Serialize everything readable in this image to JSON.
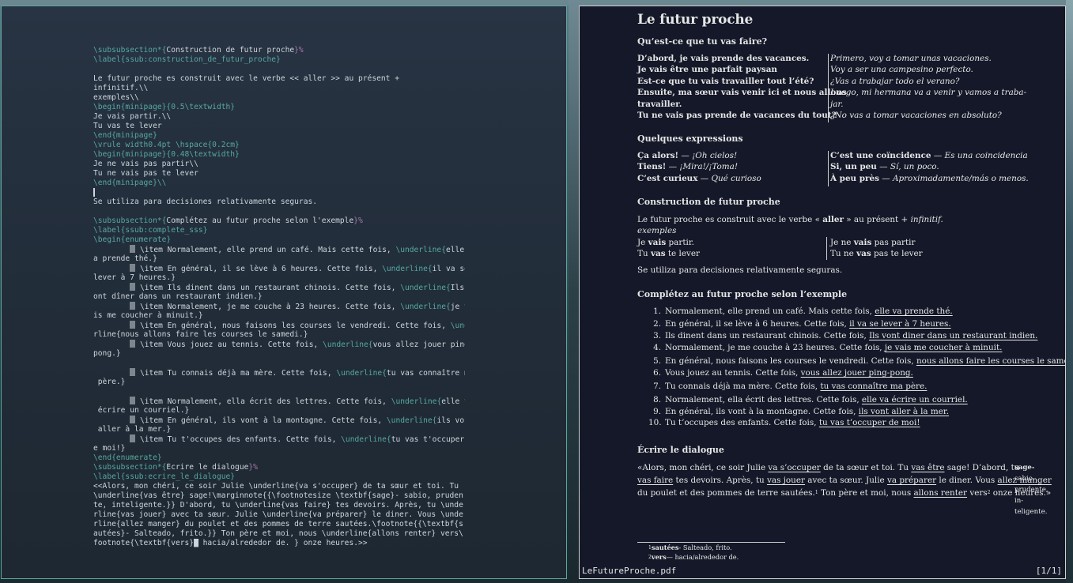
{
  "editor": {
    "lines": [
      [
        "",
        "\\subsubsection*{",
        "Construction de futur proche",
        "}%"
      ],
      [
        "",
        "\\label{ssub:construction_de_futur_proche}",
        "",
        ""
      ],
      [
        "",
        "",
        "",
        ""
      ],
      [
        "Le futur proche es construit avec le verbe << aller >> au présent +",
        "",
        "",
        ""
      ],
      [
        "infinitif.\\\\",
        "",
        "",
        ""
      ],
      [
        "exemples\\\\",
        "",
        "",
        ""
      ],
      [
        "",
        "\\begin{minipage}",
        "{0.5\\textwidth}",
        ""
      ],
      [
        "Je vais partir.\\\\",
        "",
        "",
        ""
      ],
      [
        "Tu vas te lever",
        "",
        "",
        ""
      ],
      [
        "",
        "\\end{minipage}",
        "",
        ""
      ],
      [
        "",
        "\\vrule width",
        "0.4pt \\hspace{0.2cm}",
        ""
      ],
      [
        "",
        "\\begin{minipage}",
        "{0.48\\textwidth}",
        ""
      ],
      [
        "Je ne vais pas partir\\\\",
        "",
        "",
        ""
      ],
      [
        "Tu ne vais pas te lever",
        "",
        "",
        ""
      ],
      [
        "",
        "\\end{minipage}\\\\",
        "",
        ""
      ],
      [
        "CURSOR",
        "",
        "",
        ""
      ],
      [
        "Se utiliza para decisiones relativamente seguras.",
        "",
        "",
        ""
      ],
      [
        "",
        "",
        "",
        ""
      ],
      [
        "",
        "\\subsubsection*{",
        "Complétez au futur proche selon l'exemple",
        "}%"
      ],
      [
        "",
        "\\label{ssub:complete_sss}",
        "",
        ""
      ],
      [
        "",
        "\\begin{enumerate}",
        "",
        ""
      ],
      [
        "ITEM",
        "Normalement, elle prend un café. Mais cette fois, ",
        "\\underline{",
        "elle v"
      ],
      [
        "a prende thé.}",
        "",
        "",
        ""
      ],
      [
        "ITEM",
        "En général, il se lève à 6 heures. Cette fois, ",
        "\\underline{",
        "il va se"
      ],
      [
        "lever à 7 heures.}",
        "",
        "",
        ""
      ],
      [
        "ITEM",
        "Ils dinent dans un restaurant chinois. Cette fois, ",
        "\\underline{",
        "Ils v"
      ],
      [
        "ont dîner dans un restaurant indien.}",
        "",
        "",
        ""
      ],
      [
        "ITEM",
        "Normalement, je me couche à 23 heures. Cette fois, ",
        "\\underline{",
        "je va"
      ],
      [
        "is me coucher à minuit.}",
        "",
        "",
        ""
      ],
      [
        "ITEM",
        "En général, nous faisons les courses le vendredi. Cette fois, ",
        "\\unde",
        ""
      ],
      [
        "rline{nous allons faire les courses le samedi.}",
        "",
        "",
        ""
      ],
      [
        "ITEM",
        "Vous jouez au tennis. Cette fois, ",
        "\\underline{",
        "vous allez jouer ping-"
      ],
      [
        "pong.}",
        "",
        "",
        ""
      ],
      [
        "",
        "",
        "",
        ""
      ],
      [
        "ITEM",
        "Tu connais déjà ma mère. Cette fois, ",
        "\\underline{",
        "tu vas connaître ma"
      ],
      [
        " père.}",
        "",
        "",
        ""
      ],
      [
        "",
        "",
        "",
        ""
      ],
      [
        "ITEM",
        "Normalement, ella écrit des lettres. Cette fois, ",
        "\\underline{",
        "elle va"
      ],
      [
        " écrire un courriel.}",
        "",
        "",
        ""
      ],
      [
        "ITEM",
        "En général, ils vont à la montagne. Cette fois, ",
        "\\underline{",
        "ils vont"
      ],
      [
        " aller à la mer.}",
        "",
        "",
        ""
      ],
      [
        "ITEM",
        "Tu t'occupes des enfants. Cette fois, ",
        "\\underline{",
        "tu vas t'occuper d"
      ],
      [
        "e moi!}",
        "",
        "",
        ""
      ],
      [
        "",
        "\\end{enumerate}",
        "",
        ""
      ],
      [
        "",
        "\\subsubsection*{",
        "Écrire le dialogue",
        "}%"
      ],
      [
        "",
        "\\label{ssub:ecrire_le_dialogue}",
        "",
        ""
      ],
      [
        "<<Alors, mon chéri, ce soir Julie \\underline{va s'occuper} de ta sœur et toi. Tu",
        "",
        "",
        ""
      ],
      [
        "\\underline{vas être} sage!\\marginnote{{\\footnotesize \\textbf{sage}- sabio, pruden",
        "",
        "",
        ""
      ],
      [
        "te, inteligente.}} D'abord, tu \\underline{vas faire} tes devoirs. Après, tu \\unde",
        "",
        "",
        ""
      ],
      [
        "rline{vas jouer} avec ta sœur. Julie \\underline{va préparer} le diner. Vous \\unde",
        "",
        "",
        ""
      ],
      [
        "rline{allez manger} du poulet et des pommes de terre sautées.\\footnote{{\\textbf{s",
        "",
        "",
        ""
      ],
      [
        "autées}- Salteado, frito.}} Ton père et moi, nous \\underline{allons renter} vers\\",
        "",
        "",
        ""
      ],
      [
        "footnote{\\textbf{vers}█ hacia/alrededor de. } onze heures.>>",
        "",
        "",
        ""
      ]
    ]
  },
  "viewer": {
    "title": "Le futur proche",
    "s1_title": "Qu’est-ce que tu vas faire?",
    "s1_left": [
      "D’abord, je vais prende des vacances.",
      "Je vais être une parfait paysan",
      "Est-ce que tu vais travailler tout l’été?",
      "Ensuite, ma sœur vais venir ici et nous allons",
      "travailler.",
      "Tu ne vais pas prende de vacances du tout?"
    ],
    "s1_right": [
      "Primero, voy a tomar unas vacaciones.",
      "Voy a ser una campesino perfecto.",
      "¿Vas a trabajar todo el verano?",
      "Luego, mi hermana va a venir y vamos a traba-",
      "jar.",
      "¿No vas a tomar vacaciones en absoluto?"
    ],
    "s2_title": "Quelques expressions",
    "s2_left": [
      [
        "Ça alors!",
        " — ",
        "¡Oh cielos!"
      ],
      [
        "Tiens!",
        " — ",
        "¡Mira!/¡Toma!"
      ],
      [
        "C’est curieux",
        " — ",
        "Qué curioso"
      ]
    ],
    "s2_right": [
      [
        "C’est une coïncidence",
        " — ",
        "Es una coincidencia"
      ],
      [
        "Si, un peu",
        " — ",
        "Sí, un poco."
      ],
      [
        "À peu près",
        " — ",
        "Aproximadamente/más o menos."
      ]
    ],
    "s3_title": "Construction de futur proche",
    "s3_p1a": "Le futur proche es construit avec le verbe « ",
    "s3_p1b": "aller",
    "s3_p1c": " » au présent + ",
    "s3_p1d": "infinitif.",
    "s3_exemples": "exemples",
    "s3_ex_l1a": "Je ",
    "s3_ex_l1b": "vais",
    "s3_ex_l1c": " partir.",
    "s3_ex_l2a": "Tu ",
    "s3_ex_l2b": "vas",
    "s3_ex_l2c": " te lever",
    "s3_ex_r1a": "Je ne ",
    "s3_ex_r1b": "vais",
    "s3_ex_r1c": " pas partir",
    "s3_ex_r2a": "Tu ne ",
    "s3_ex_r2b": "vas",
    "s3_ex_r2c": " pas te lever",
    "s3_p2": "Se utiliza para decisiones relativamente seguras.",
    "s4_title": "Complétez au futur proche selon l’exemple",
    "s4_items": [
      [
        "1.",
        "Normalement, elle prend un café. Mais cette fois, ",
        "elle va prende thé."
      ],
      [
        "2.",
        "En général, il se lève à 6 heures. Cette fois, ",
        "il va se lever à 7 heures."
      ],
      [
        "3.",
        "Ils dinent dans un restaurant chinois. Cette fois, ",
        "Ils vont diner dans un restaurant indien."
      ],
      [
        "4.",
        "Normalement, je me couche à 23 heures. Cette fois, ",
        "je vais me coucher à minuit."
      ],
      [
        "5.",
        "En général, nous faisons les courses le vendredi. Cette fois, ",
        "nous allons faire les courses le samedi."
      ],
      [
        "6.",
        "Vous jouez au tennis. Cette fois, ",
        "vous allez jouer ping-pong."
      ],
      [
        "7.",
        "Tu connais déjà ma mère. Cette fois, ",
        "tu vas connaître ma père."
      ],
      [
        "8.",
        "Normalement, ella écrit des lettres. Cette fois, ",
        "elle va écrire un courriel."
      ],
      [
        "9.",
        "En général, ils vont à la montagne. Cette fois, ",
        "ils vont aller à la mer."
      ],
      [
        "10.",
        "Tu t’occupes des enfants. Cette fois, ",
        "tu vas t’occuper de moi!"
      ]
    ],
    "s5_title": "Écrire le dialogue",
    "s5_lines": [
      [
        [
          "«Alors, mon chéri, ce soir Julie ",
          0
        ],
        [
          "va s’occuper",
          1
        ],
        [
          " de ta sœur et toi.  Tu ",
          0
        ],
        [
          "vas être",
          1
        ],
        [
          " sage!  D’abord, tu",
          0
        ]
      ],
      [
        [
          "vas faire",
          1
        ],
        [
          " tes devoirs.  Après, tu ",
          0
        ],
        [
          "vas jouer",
          1
        ],
        [
          " avec ta sœur. Julie ",
          0
        ],
        [
          "va préparer",
          1
        ],
        [
          " le diner.  Vous ",
          0
        ],
        [
          "allez manger",
          1
        ]
      ],
      [
        [
          "du poulet et des pommes de terre sautées.",
          0
        ],
        [
          "1",
          2
        ],
        [
          " Ton père et moi, nous ",
          0
        ],
        [
          "allons renter",
          1
        ],
        [
          " vers",
          0
        ],
        [
          "2",
          2
        ],
        [
          " onze heures.»",
          0
        ]
      ]
    ],
    "margin_note": [
      "sage-",
      "sabio,",
      "prudente,",
      "in-",
      "teligente."
    ],
    "footnotes": [
      [
        "1",
        "sautées",
        "- Salteado, frito."
      ],
      [
        "2",
        "vers",
        "— hacia/alrededor de."
      ]
    ],
    "status_file": "LeFutureProche.pdf",
    "status_page": "[1/1]"
  }
}
